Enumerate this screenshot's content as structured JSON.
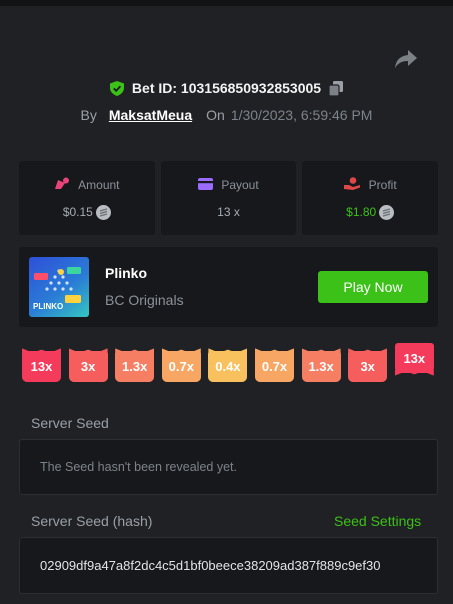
{
  "header": {
    "bet_id_label": "Bet ID: 103156850932853005",
    "by_label": "By",
    "username": "MaksatMeua",
    "on_label": "On",
    "date": "1/30/2023, 6:59:46 PM"
  },
  "icons": {
    "share": "share-arrow-icon",
    "verified": "shield-check-icon",
    "copy": "copy-icon",
    "amount": "coins-icon",
    "payout": "wallet-icon",
    "profit": "hand-coin-icon",
    "currency": "coin-icon"
  },
  "stats": {
    "amount": {
      "label": "Amount",
      "value": "$0.15"
    },
    "payout": {
      "label": "Payout",
      "value": "13 x"
    },
    "profit": {
      "label": "Profit",
      "value": "$1.80"
    }
  },
  "game": {
    "thumb_text": "PLINKO",
    "name": "Plinko",
    "provider": "BC Originals",
    "play_label": "Play Now"
  },
  "multipliers": [
    {
      "label": "13x",
      "color": "#f53b5c",
      "hit": false
    },
    {
      "label": "3x",
      "color": "#f65e5e",
      "hit": false
    },
    {
      "label": "1.3x",
      "color": "#f67e63",
      "hit": false
    },
    {
      "label": "0.7x",
      "color": "#f7a763",
      "hit": false
    },
    {
      "label": "0.4x",
      "color": "#f9c05e",
      "hit": false
    },
    {
      "label": "0.7x",
      "color": "#f7a763",
      "hit": false
    },
    {
      "label": "1.3x",
      "color": "#f67e63",
      "hit": false
    },
    {
      "label": "3x",
      "color": "#f65e5e",
      "hit": false
    },
    {
      "label": "13x",
      "color": "#f53b5c",
      "hit": true
    }
  ],
  "server_seed": {
    "label": "Server Seed",
    "value": "The Seed hasn't been revealed yet."
  },
  "server_seed_hash": {
    "label": "Server Seed (hash)",
    "settings_label": "Seed Settings",
    "value": "02909df9a47a8f2dc4c5d1bf0beece38209ad387f889c9ef30"
  },
  "colors": {
    "accent_green": "#3bc117",
    "amount_icon": "#e8437a",
    "payout_icon": "#9b6bff",
    "profit_icon": "#e04747"
  }
}
